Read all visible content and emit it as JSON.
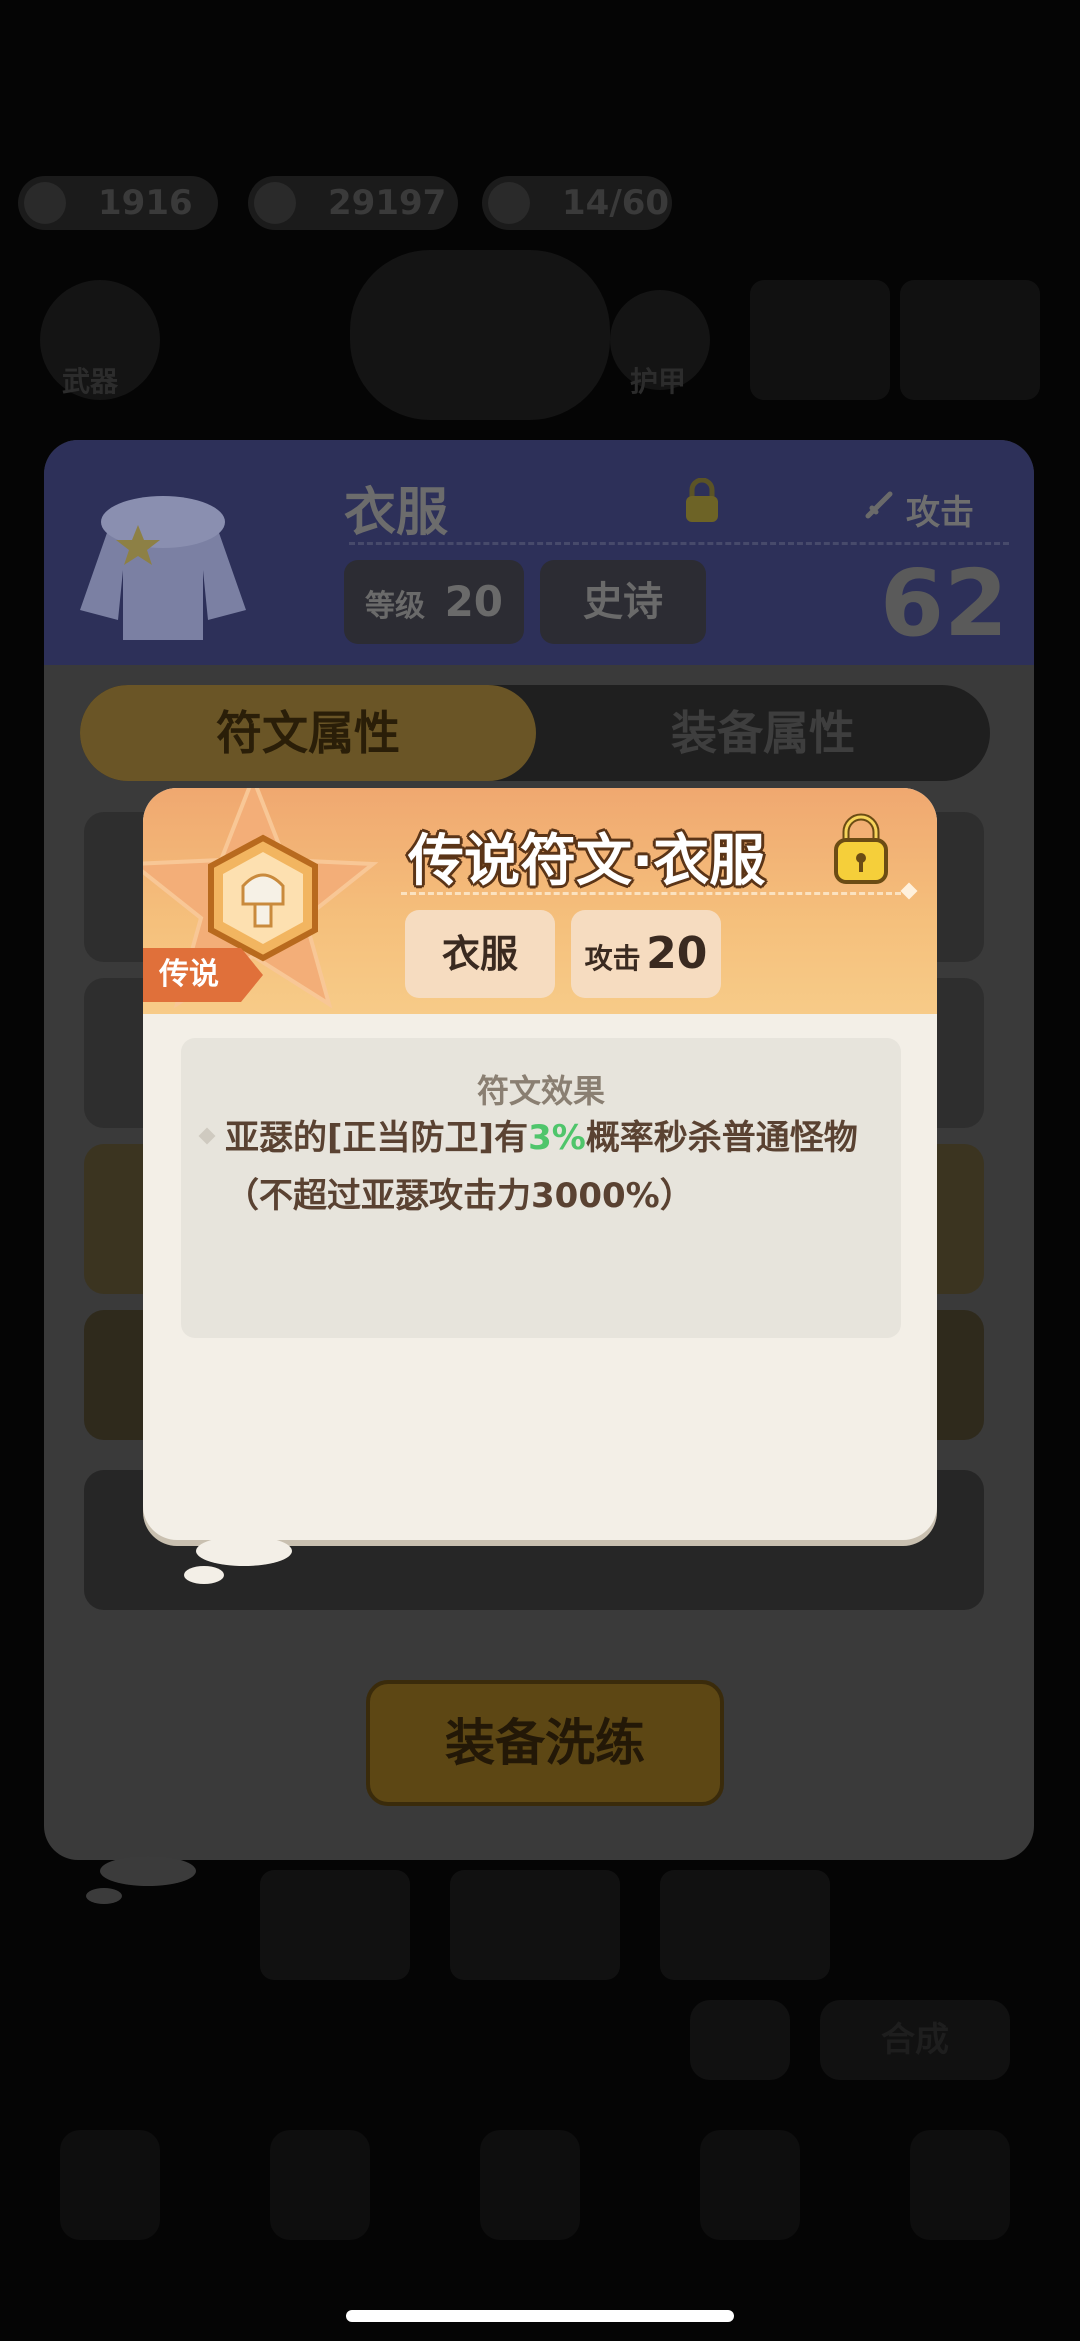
{
  "background": {
    "resources": [
      "1916",
      "29197",
      "14/60"
    ],
    "stage_labels": [
      "武器",
      "护甲"
    ]
  },
  "panel": {
    "item_name": "衣服",
    "level_label": "等级",
    "level_value": "20",
    "rarity": "史诗",
    "attack_label": "攻击",
    "power_value": "62",
    "tabs": [
      "符文属性",
      "装备属性"
    ],
    "refine_button": "装备洗练"
  },
  "popup": {
    "rarity_tag": "传说",
    "title": "传说符文·衣服",
    "slot_chip": "衣服",
    "stat_label": "攻击",
    "stat_value": "20",
    "effect_title": "符文效果",
    "effect_prefix": "亚瑟的[正当防卫]有",
    "effect_highlight": "3%",
    "effect_suffix": "概率秒杀普通怪物",
    "effect_note": "（不超过亚瑟攻击力3000%）",
    "colors": {
      "header": "#f0a870",
      "body": "#f3efe7",
      "highlight": "#4fc56b",
      "tag": "#e0703a"
    }
  },
  "bottom_bar": {
    "merge_button": "合成"
  }
}
